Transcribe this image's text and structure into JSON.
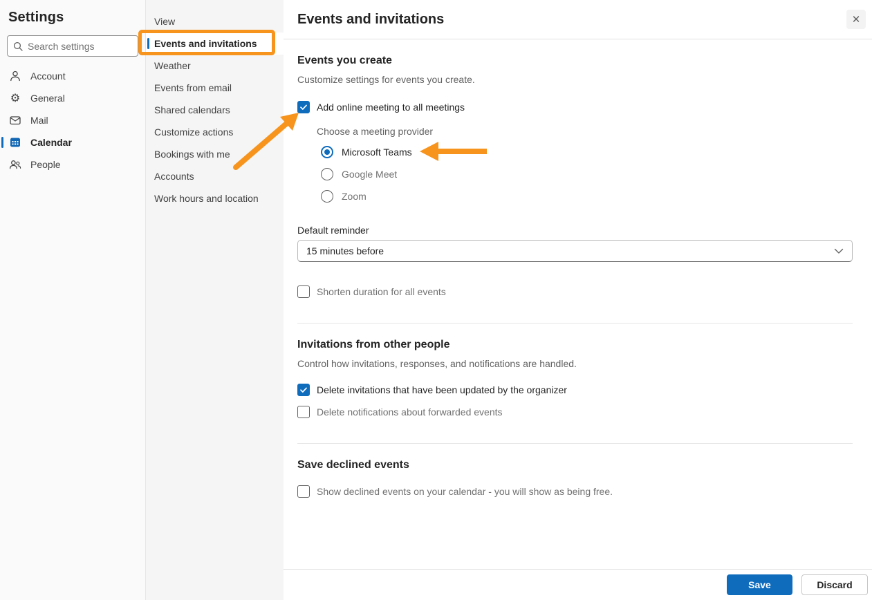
{
  "colors": {
    "accent_blue": "#0f6cbd",
    "annotation_orange": "#f7941d"
  },
  "sidebar": {
    "title": "Settings",
    "search_placeholder": "Search settings",
    "items": [
      {
        "label": "Account",
        "icon": "person-icon",
        "selected": false
      },
      {
        "label": "General",
        "icon": "gear-icon",
        "selected": false
      },
      {
        "label": "Mail",
        "icon": "mail-icon",
        "selected": false
      },
      {
        "label": "Calendar",
        "icon": "calendar-icon",
        "selected": true
      },
      {
        "label": "People",
        "icon": "people-icon",
        "selected": false
      }
    ]
  },
  "category_nav": {
    "items": [
      {
        "label": "View",
        "selected": false
      },
      {
        "label": "Events and invitations",
        "selected": true,
        "annotated": true
      },
      {
        "label": "Weather",
        "selected": false
      },
      {
        "label": "Events from email",
        "selected": false
      },
      {
        "label": "Shared calendars",
        "selected": false
      },
      {
        "label": "Customize actions",
        "selected": false
      },
      {
        "label": "Bookings with me",
        "selected": false
      },
      {
        "label": "Accounts",
        "selected": false
      },
      {
        "label": "Work hours and location",
        "selected": false
      }
    ]
  },
  "panel": {
    "title": "Events and invitations",
    "close_glyph": "✕",
    "events_you_create": {
      "heading": "Events you create",
      "description": "Customize settings for events you create.",
      "add_online_meeting": {
        "label": "Add online meeting to all meetings",
        "checked": true
      },
      "provider_group_label": "Choose a meeting provider",
      "providers": [
        {
          "label": "Microsoft Teams",
          "selected": true
        },
        {
          "label": "Google Meet",
          "selected": false
        },
        {
          "label": "Zoom",
          "selected": false
        }
      ],
      "default_reminder_label": "Default reminder",
      "default_reminder_value": "15 minutes before",
      "shorten_duration": {
        "label": "Shorten duration for all events",
        "checked": false
      }
    },
    "invitations_from_other_people": {
      "heading": "Invitations from other people",
      "description": "Control how invitations, responses, and notifications are handled.",
      "options": [
        {
          "label": "Delete invitations that have been updated by the organizer",
          "checked": true
        },
        {
          "label": "Delete notifications about forwarded events",
          "checked": false
        }
      ]
    },
    "save_declined_events": {
      "heading": "Save declined events",
      "option": {
        "label": "Show declined events on your calendar - you will show as being free.",
        "checked": false
      }
    },
    "footer": {
      "save_label": "Save",
      "discard_label": "Discard"
    }
  }
}
